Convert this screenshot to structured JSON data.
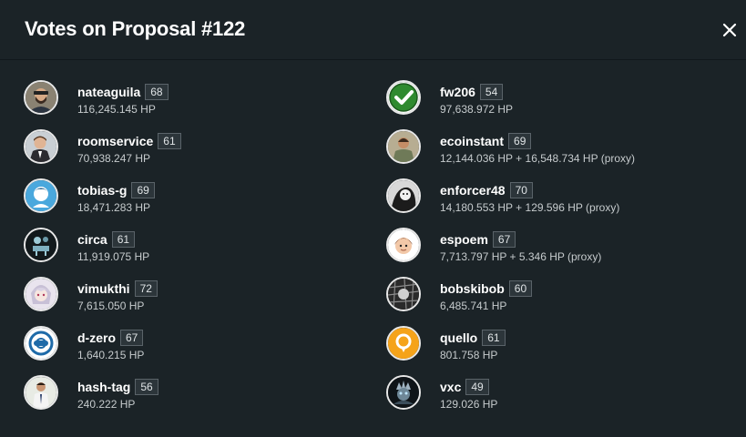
{
  "header": {
    "title": "Votes on Proposal #122",
    "close_icon": "close-icon"
  },
  "left_column": [
    {
      "name": "nateaguila",
      "reputation": "68",
      "hp": "116,245.145 HP"
    },
    {
      "name": "roomservice",
      "reputation": "61",
      "hp": "70,938.247 HP"
    },
    {
      "name": "tobias-g",
      "reputation": "69",
      "hp": "18,471.283 HP"
    },
    {
      "name": "circa",
      "reputation": "61",
      "hp": "11,919.075 HP"
    },
    {
      "name": "vimukthi",
      "reputation": "72",
      "hp": "7,615.050 HP"
    },
    {
      "name": "d-zero",
      "reputation": "67",
      "hp": "1,640.215 HP"
    },
    {
      "name": "hash-tag",
      "reputation": "56",
      "hp": "240.222 HP"
    }
  ],
  "right_column": [
    {
      "name": "fw206",
      "reputation": "54",
      "hp": "97,638.972 HP"
    },
    {
      "name": "ecoinstant",
      "reputation": "69",
      "hp": "12,144.036 HP + 16,548.734 HP (proxy)"
    },
    {
      "name": "enforcer48",
      "reputation": "70",
      "hp": "14,180.553 HP + 129.596 HP (proxy)"
    },
    {
      "name": "espoem",
      "reputation": "67",
      "hp": "7,713.797 HP + 5.346 HP (proxy)"
    },
    {
      "name": "bobskibob",
      "reputation": "60",
      "hp": "6,485.741 HP"
    },
    {
      "name": "quello",
      "reputation": "61",
      "hp": "801.758 HP"
    },
    {
      "name": "vxc",
      "reputation": "49",
      "hp": "129.026 HP"
    }
  ],
  "colors": {
    "background": "#1b2327",
    "text": "#ffffff",
    "muted": "#c6cbcd",
    "badge_border": "#5a6369"
  }
}
